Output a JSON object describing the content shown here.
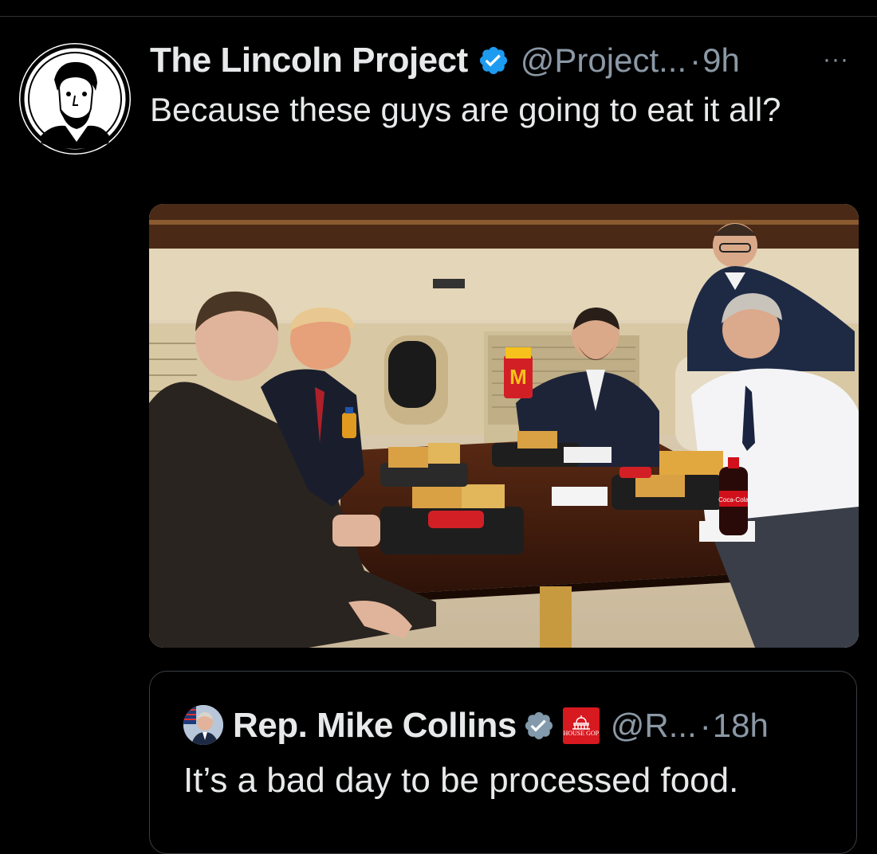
{
  "tweet": {
    "display_name": "The Lincoln Project",
    "handle": "@Project...",
    "separator": "·",
    "time": "9h",
    "more_label": "···",
    "text": "Because these guys are going to eat it all?",
    "avatar_icon": "lincoln-silhouette-icon",
    "verified_icon": "verified-badge-icon",
    "verified_color": "#1d9bf0"
  },
  "quoted_tweet": {
    "display_name": "Rep. Mike Collins",
    "handle": "@R...",
    "separator": "·",
    "time": "18h",
    "text": "It’s a bad day to be processed food.",
    "verified_icon": "verified-badge-gray-icon",
    "verified_color": "#829aab",
    "affiliate_badge_icon": "house-gop-capitol-icon",
    "affiliate_badge_text": "HOUSE GOP",
    "affiliate_badge_color": "#d71920"
  },
  "media": {
    "description_icon": "photo-icon",
    "cup_logo": "M",
    "bottle_label": "Coca-Cola"
  }
}
